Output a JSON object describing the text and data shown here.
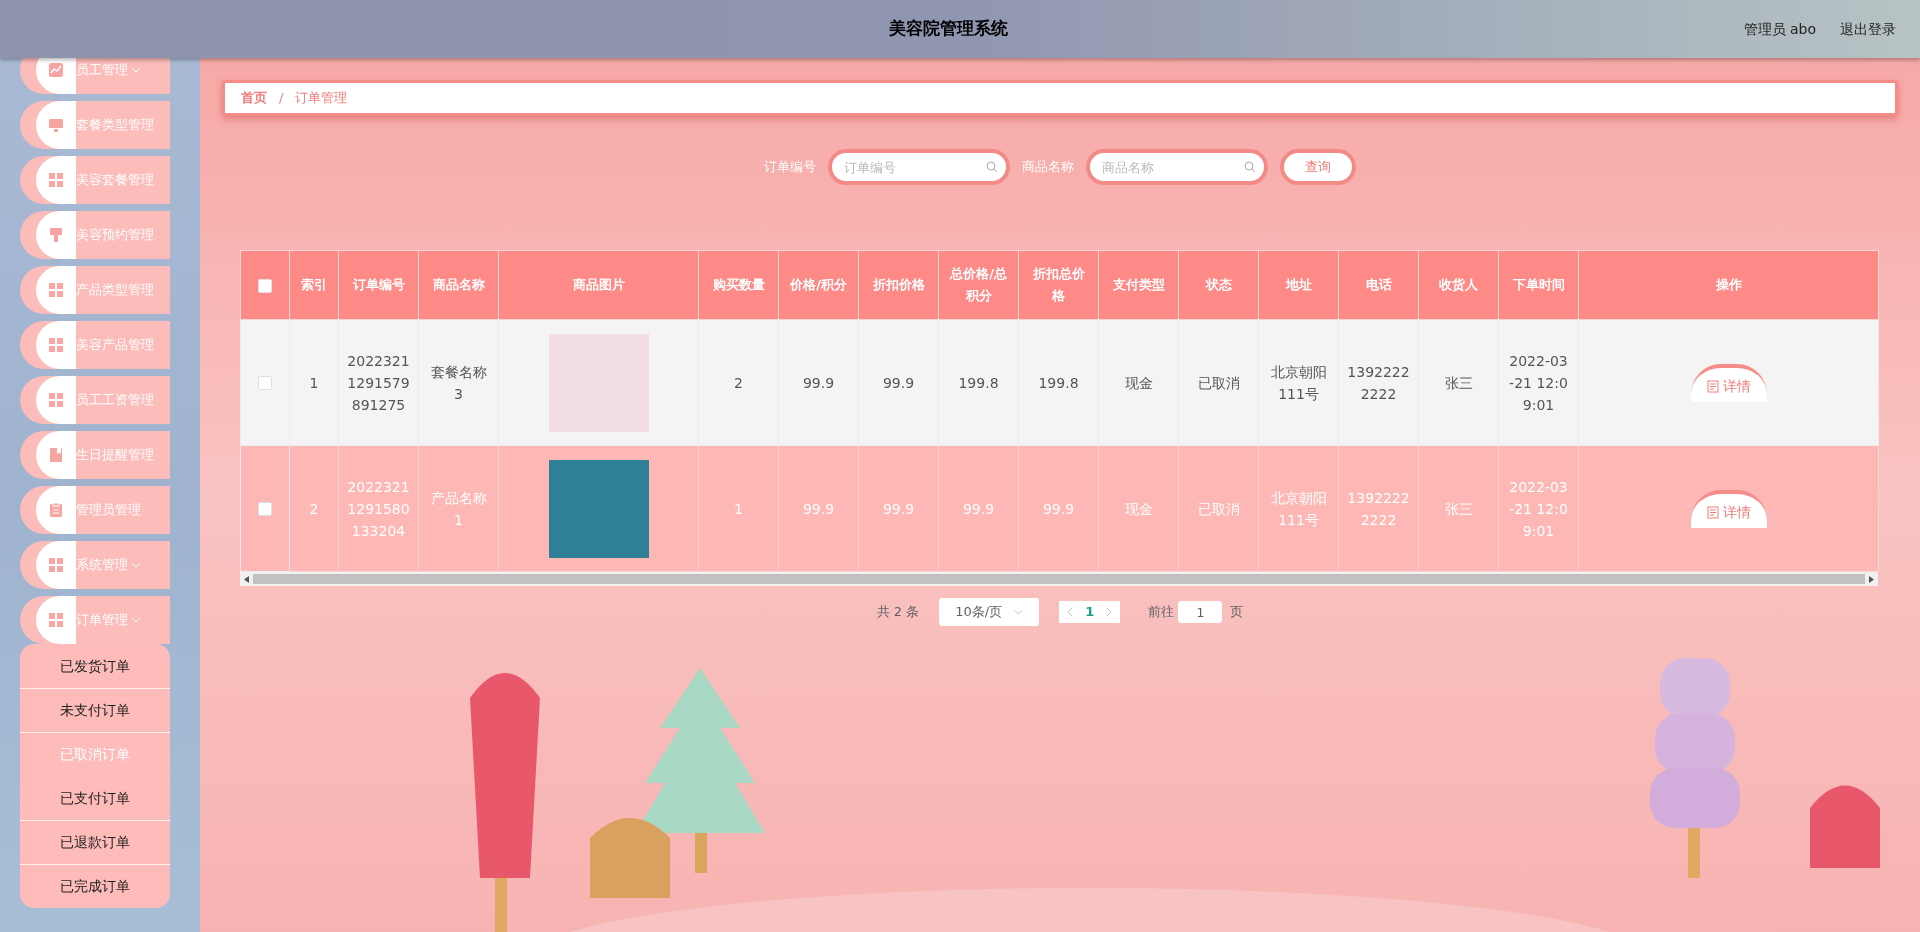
{
  "header": {
    "title": "美容院管理系统",
    "user": "管理员 abo",
    "logout": "退出登录"
  },
  "sidebar": {
    "items": [
      {
        "label": "员工管理",
        "kind": "group"
      },
      {
        "label": "套餐类型管理",
        "kind": "link"
      },
      {
        "label": "美容套餐管理",
        "kind": "link"
      },
      {
        "label": "美容预约管理",
        "kind": "link"
      },
      {
        "label": "产品类型管理",
        "kind": "link"
      },
      {
        "label": "美容产品管理",
        "kind": "link"
      },
      {
        "label": "员工工资管理",
        "kind": "link"
      },
      {
        "label": "生日提醒管理",
        "kind": "link"
      },
      {
        "label": "管理员管理",
        "kind": "link"
      },
      {
        "label": "系统管理",
        "kind": "group"
      },
      {
        "label": "订单管理",
        "kind": "group",
        "children": [
          {
            "label": "已发货订单",
            "selected": false
          },
          {
            "label": "未支付订单",
            "selected": false
          },
          {
            "label": "已取消订单",
            "selected": true
          },
          {
            "label": "已支付订单",
            "selected": false
          },
          {
            "label": "已退款订单",
            "selected": false
          },
          {
            "label": "已完成订单",
            "selected": false
          }
        ]
      }
    ]
  },
  "breadcrumb": {
    "items": [
      "首页",
      "订单管理"
    ],
    "separator": "/"
  },
  "search": {
    "fields": [
      {
        "label": "订单编号",
        "placeholder": "订单编号"
      },
      {
        "label": "商品名称",
        "placeholder": "商品名称"
      }
    ],
    "button": "查询"
  },
  "table": {
    "select_all_checked": false,
    "columns": [
      "索引",
      "订单编号",
      "商品名称",
      "商品图片",
      "购买数量",
      "价格/积分",
      "折扣价格",
      "总价格/总积分",
      "折扣总价格",
      "支付类型",
      "状态",
      "地址",
      "电话",
      "收货人",
      "下单时间",
      "操作"
    ],
    "rows": [
      {
        "checked": false,
        "cells": [
          "1",
          "20223211291579891275",
          "套餐名称3",
          null,
          "2",
          "99.9",
          "99.9",
          "199.8",
          "199.8",
          "现金",
          "已取消",
          "北京朝阳111号",
          "13922222222",
          "张三",
          "2022-03-21 12:09:01"
        ],
        "action": "详情"
      },
      {
        "checked": false,
        "cells": [
          "2",
          "20223211291580133204",
          "产品名称1",
          null,
          "1",
          "99.9",
          "99.9",
          "99.9",
          "99.9",
          "现金",
          "已取消",
          "北京朝阳111号",
          "13922222222",
          "张三",
          "2022-03-21 12:09:01"
        ],
        "action": "详情"
      }
    ]
  },
  "pagination": {
    "total": "共 2 条",
    "page_size": "10条/页",
    "pages": [
      {
        "label": "1",
        "selected": true
      }
    ],
    "goto_label": "前往",
    "goto_value": "1",
    "goto_suffix": "页"
  }
}
